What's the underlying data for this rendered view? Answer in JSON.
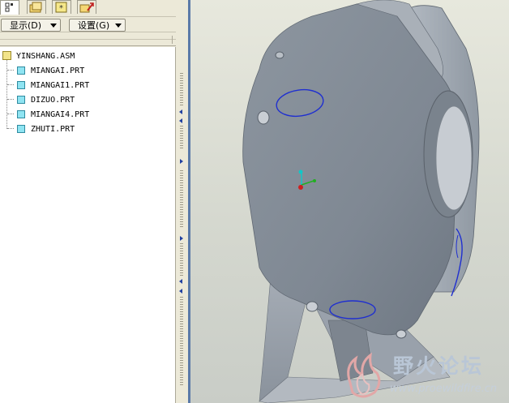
{
  "navigator": {
    "tabs": [
      {
        "name": "model-tree-tab",
        "icon": "model-tree-icon"
      },
      {
        "name": "folder-browser-tab",
        "icon": "folder-icon"
      },
      {
        "name": "favorites-tab",
        "icon": "favorites-star-icon"
      },
      {
        "name": "connections-tab",
        "icon": "connections-icon"
      }
    ],
    "toolbar": {
      "show_menu_label": "显示(D)",
      "settings_menu_label": "设置(G)"
    }
  },
  "model_tree": {
    "root": {
      "label": "YINSHANG.ASM",
      "icon": "assembly-icon"
    },
    "parts": [
      {
        "label": "MIANGAI.PRT",
        "icon": "part-icon"
      },
      {
        "label": "MIANGAI1.PRT",
        "icon": "part-icon"
      },
      {
        "label": "DIZUO.PRT",
        "icon": "part-icon"
      },
      {
        "label": "MIANGAI4.PRT",
        "icon": "part-icon"
      },
      {
        "label": "ZHUTI.PRT",
        "icon": "part-icon"
      }
    ]
  },
  "viewport": {
    "model_description": "speaker housing assembly on a stand",
    "colors": {
      "model_body": "#8e97a0",
      "edge_highlight": "#1f2fd0",
      "background": "#dcded4"
    },
    "csys_icon": "coordinate-system-icon"
  },
  "watermark": {
    "title": "野火论坛",
    "url": "www.proewildfire.cn",
    "logo_icon": "wildfire-logo-icon"
  }
}
